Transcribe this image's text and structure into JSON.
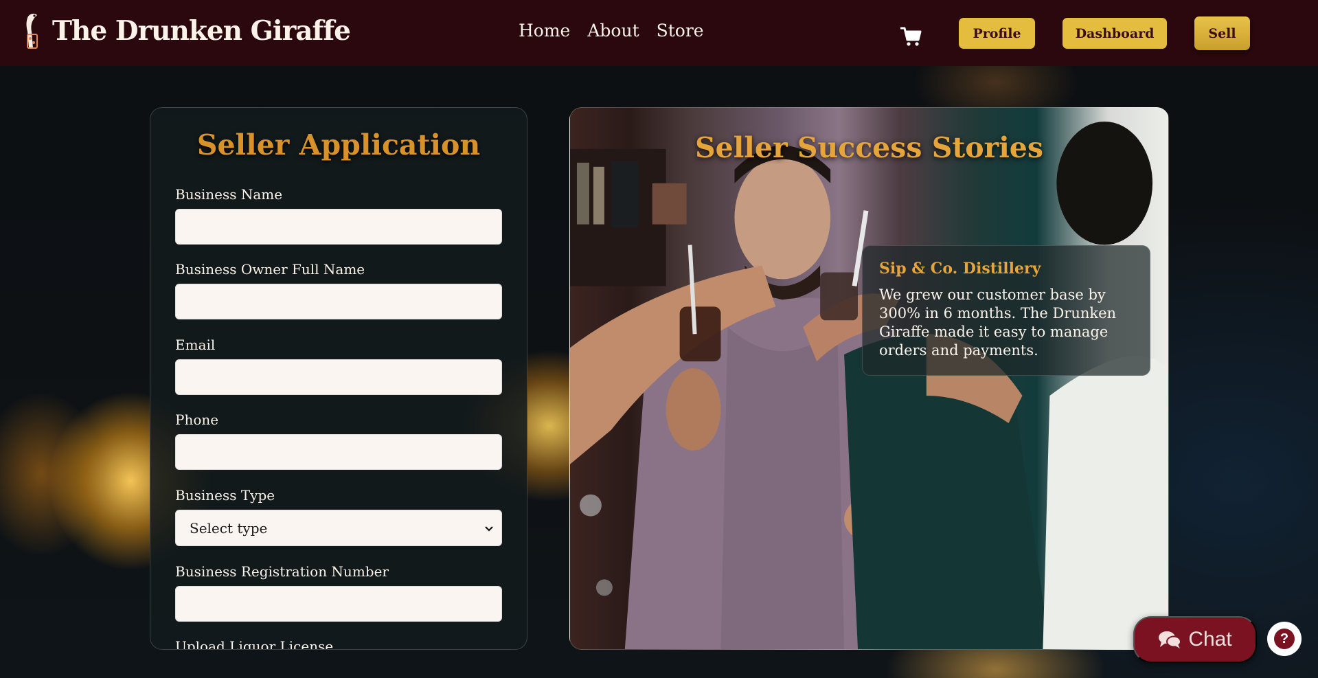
{
  "header": {
    "brand": "The Drunken Giraffe",
    "nav": [
      "Home",
      "About",
      "Store"
    ],
    "cart_icon": "shopping-cart-icon",
    "buttons": {
      "profile": "Profile",
      "dashboard": "Dashboard",
      "sell": "Sell"
    },
    "colors": {
      "background": "#2a080d",
      "button": "#e4bd3f",
      "button_text": "#3a0d12"
    }
  },
  "form": {
    "title": "Seller Application",
    "fields": [
      {
        "label": "Business Name",
        "value": "",
        "placeholder": ""
      },
      {
        "label": "Business Owner Full Name",
        "value": "",
        "placeholder": ""
      },
      {
        "label": "Email",
        "value": "",
        "placeholder": ""
      },
      {
        "label": "Phone",
        "value": "",
        "placeholder": ""
      },
      {
        "label": "Business Type",
        "selected": "Select type"
      },
      {
        "label": "Business Registration Number",
        "value": "",
        "placeholder": ""
      },
      {
        "label": "Upload Liquor License"
      }
    ],
    "title_color": "#d9922a"
  },
  "stories": {
    "title": "Seller Success Stories",
    "story": {
      "name": "Sip & Co. Distillery",
      "text": "We grew our customer base by 300% in 6 months. The Drunken Giraffe made it easy to manage orders and payments."
    }
  },
  "chat": {
    "label": "Chat",
    "icon": "chat-bubbles-icon",
    "color": "#7a1221"
  },
  "help": {
    "label": "?",
    "icon": "help-icon"
  }
}
